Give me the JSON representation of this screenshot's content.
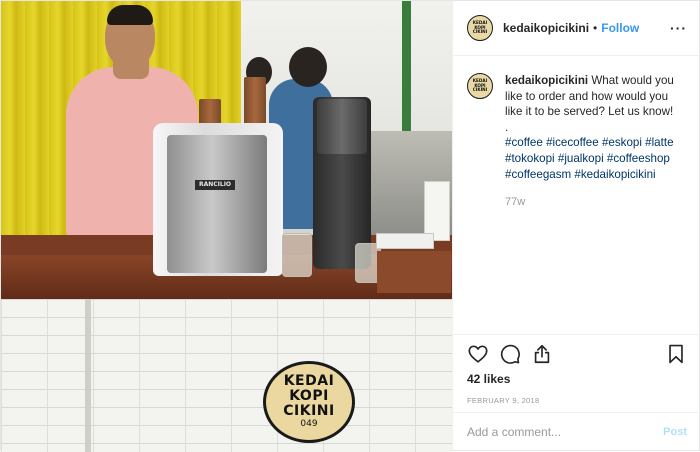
{
  "header": {
    "avatar_lines": [
      "KEDAI",
      "KOPI",
      "CIKINI"
    ],
    "username": "kedaikopicikini",
    "separator": "•",
    "follow_label": "Follow",
    "more_label": "···"
  },
  "caption": {
    "username": "kedaikopicikini",
    "text": "What would you like to order and how would you like it to be served? Let us know!",
    "separator": ".",
    "hashtags": [
      "#coffee",
      "#icecoffee",
      "#eskopi",
      "#latte",
      "#tokokopi",
      "#jualkopi",
      "#coffeeshop",
      "#coffeegasm",
      "#kedaikopicikini"
    ],
    "time_ago": "77w"
  },
  "actions": {
    "like_icon": "heart-icon",
    "comment_icon": "comment-icon",
    "share_icon": "share-icon",
    "save_icon": "bookmark-icon"
  },
  "likes": "42 likes",
  "date": "FEBRUARY 9, 2018",
  "comment_box": {
    "placeholder": "Add a comment...",
    "post_label": "Post"
  },
  "photo": {
    "machine_brand": "RANCILIO",
    "sign_lines": [
      "KEDAI",
      "KOPI",
      "CIKINI"
    ],
    "sign_number": "049"
  },
  "colors": {
    "link_blue": "#3897f0",
    "hashtag": "#003569",
    "muted": "#999999",
    "post_disabled": "#b2dffc"
  }
}
